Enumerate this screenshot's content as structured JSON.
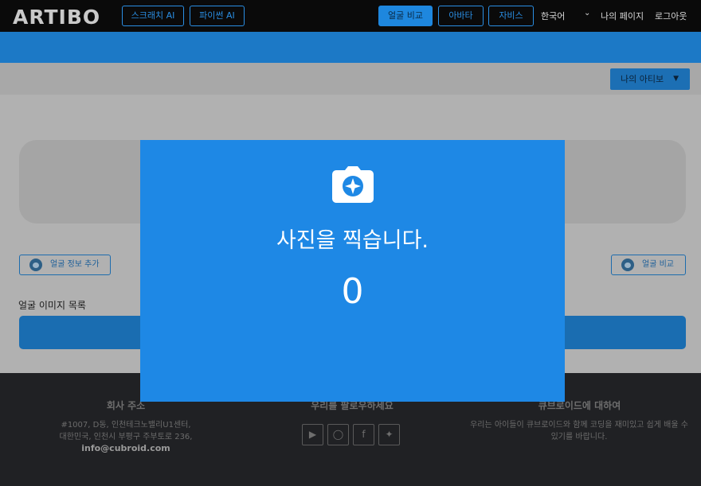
{
  "header": {
    "logo": "ARTIBO",
    "nav": {
      "scratch_ai": "스크래치 AI",
      "python_ai": "파이썬 AI",
      "face_compare": "얼굴 비교",
      "avatar": "아바타",
      "jarvis": "자비스"
    },
    "language": "한국어",
    "my_page": "나의 페이지",
    "logout": "로그아웃"
  },
  "toolbar": {
    "my_artibo": "나의 아티보"
  },
  "main": {
    "add_face_info": "얼굴 정보 추가",
    "face_compare_button": "얼굴 비교",
    "image_list_title": "얼굴 이미지 목록"
  },
  "modal": {
    "message": "사진을 찍습니다.",
    "countdown": "0"
  },
  "footer": {
    "company_title": "회사 주소",
    "address_line1": "#1007, D동, 인천테크노밸리U1센터,",
    "address_line2": "대한민국, 인천시 부평구 주부토로 236,",
    "email": "info@cubroid.com",
    "follow_title": "우리를 팔로우하세요",
    "about_title": "큐브로이드에 대하여",
    "about_line1": "우리는 아이들이 큐브로이드와 함께 코딩을 재미있고 쉽게 배울 수",
    "about_line2": "있기를 바랍니다.",
    "social_icons": [
      "youtube-icon",
      "instagram-icon",
      "facebook-icon",
      "twitter-icon"
    ]
  },
  "colors": {
    "accent_blue": "#1e88e5",
    "header_bg": "#0a0a0a",
    "footer_bg": "#202124"
  }
}
